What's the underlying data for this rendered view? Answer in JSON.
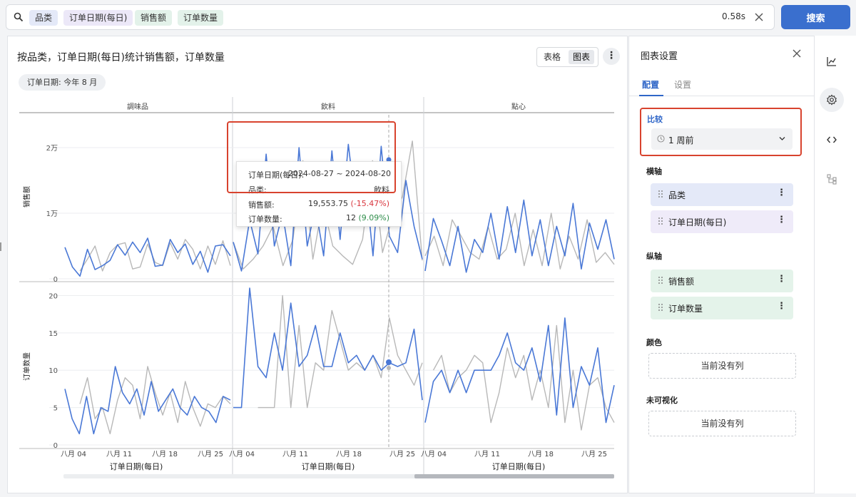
{
  "search": {
    "chips": [
      "品类",
      "订单日期(每日)",
      "销售额",
      "订单数量"
    ],
    "elapsed": "0.58s",
    "button_label": "搜索"
  },
  "main": {
    "title": "按品类，订单日期(每日)统计销售额，订单数量",
    "view_tabs": [
      "表格",
      "图表"
    ],
    "active_view": "图表",
    "filter": "订单日期: 今年 8 月"
  },
  "tooltip": {
    "rows": [
      {
        "key": "订单日期(每日):",
        "value": "2024-08-27 ~ 2024-08-20"
      },
      {
        "key": "品类:",
        "value": "飲料"
      },
      {
        "key": "销售额:",
        "value": "19,553.75",
        "delta": "(-15.47%)"
      },
      {
        "key": "订单数量:",
        "value": "12",
        "delta": "(9.09%)"
      }
    ]
  },
  "chart_data": {
    "type": "line",
    "facets": [
      "調味品",
      "飲料",
      "點心"
    ],
    "rows": [
      {
        "ylabel": "销售额",
        "ticks": [
          "0",
          "1万",
          "2万"
        ],
        "ylim": [
          0,
          25000
        ]
      },
      {
        "ylabel": "订单数量",
        "ticks": [
          "0",
          "5",
          "10",
          "15",
          "20"
        ],
        "ylim": [
          0,
          21
        ]
      }
    ],
    "x_ticks": [
      "八月 04",
      "八月 11",
      "八月 18",
      "八月 25"
    ],
    "xlabel": "订单日期(每日)",
    "colors": {
      "current": "#4a78d6",
      "previous": "#b8b8b8"
    },
    "series": [
      {
        "values": [
          [
            4800,
            1800,
            400,
            4500,
            1400,
            2000,
            2800,
            5200,
            3600,
            5600,
            4000,
            6200,
            1900,
            2100,
            6000,
            4000,
            5300,
            2200,
            4200,
            1000,
            5000,
            5200,
            3500
          ],
          [
            5600,
            1200,
            9000,
            3800,
            19000,
            5000,
            10000,
            2000,
            20000,
            5000,
            11000,
            3500,
            19500,
            6000,
            20500,
            10000,
            16000,
            3500,
            20200,
            6500,
            4000,
            15000,
            8000,
            3000
          ],
          [
            1200,
            9200,
            5800,
            2000,
            8000,
            1000,
            6000,
            4000,
            10000,
            3000,
            11000,
            4000,
            12000,
            3500,
            9000,
            2000,
            8000,
            3500,
            11500,
            1500,
            8500,
            4500,
            9000,
            3000
          ]
        ]
      },
      {
        "values": [
          [
            7.5,
            3.5,
            1.5,
            6.5,
            1.5,
            5,
            4.5,
            10.5,
            7,
            5.5,
            7.5,
            4,
            8.5,
            4.5,
            6,
            7.5,
            5,
            4,
            6.5,
            5,
            4.5,
            3,
            6.5,
            6
          ],
          [
            5,
            5,
            21,
            10.5,
            9,
            15,
            10,
            19,
            10.5,
            12,
            16,
            10.5,
            10.5,
            15,
            11,
            12,
            10,
            12,
            10,
            11,
            10.5,
            11,
            15.5,
            6
          ],
          [
            3,
            8.5,
            10,
            7,
            10,
            7,
            10,
            10,
            10,
            12,
            15,
            11,
            10,
            13,
            8.5,
            16,
            4,
            17,
            5,
            10.5,
            8,
            13,
            3,
            8
          ]
        ]
      }
    ],
    "prev_values": [
      [
        [
          null,
          null,
          1200,
          3000,
          5000,
          1200,
          4000,
          5200,
          5500,
          1500,
          1800,
          5300,
          2500,
          2000,
          5500,
          3000,
          6000,
          4500,
          1500,
          5000,
          2200,
          5800,
          2000
        ],
        [
          5600,
          1500,
          3000,
          5000,
          8000,
          2000,
          6000,
          18000,
          3000,
          11500,
          5000,
          3500,
          2200,
          6000,
          18000,
          4000,
          9500,
          12500,
          21000,
          2800
        ],
        [
          3500,
          6500,
          2000,
          9000,
          6500,
          4000,
          3000,
          8000,
          3000,
          4500,
          10000,
          2000,
          7500,
          2000,
          10000,
          1500,
          6500,
          3000,
          9000,
          2500,
          4000,
          2200
        ]
      ],
      [
        [
          null,
          null,
          5.5,
          9,
          3.5,
          5,
          1.5,
          6,
          9,
          8,
          3.5,
          10.5,
          7,
          4,
          7,
          3,
          8.5,
          5,
          2.5,
          5.5,
          5,
          6.5,
          5.5
        ],
        [
          null,
          null,
          null,
          5,
          5,
          5,
          20,
          5,
          16,
          5,
          11,
          10,
          18,
          14,
          10,
          11,
          10,
          12,
          9,
          17,
          12,
          10,
          8,
          11
        ],
        [
          null,
          10,
          12,
          7,
          9,
          10,
          12,
          11,
          3,
          7,
          13,
          9,
          12,
          6,
          10,
          5,
          16,
          3,
          10,
          2,
          8,
          9,
          5,
          3
        ]
      ]
    ]
  },
  "side": {
    "title": "图表设置",
    "tabs": [
      "配置",
      "设置"
    ],
    "compare_label": "比较",
    "compare_value": "1 周前",
    "x_axis_label": "横轴",
    "x_fields": [
      "品类",
      "订单日期(每日)"
    ],
    "y_axis_label": "纵轴",
    "y_fields": [
      "销售额",
      "订单数量"
    ],
    "color_label": "颜色",
    "color_empty": "当前没有列",
    "invisible_label": "未可视化",
    "invisible_empty": "当前没有列"
  }
}
